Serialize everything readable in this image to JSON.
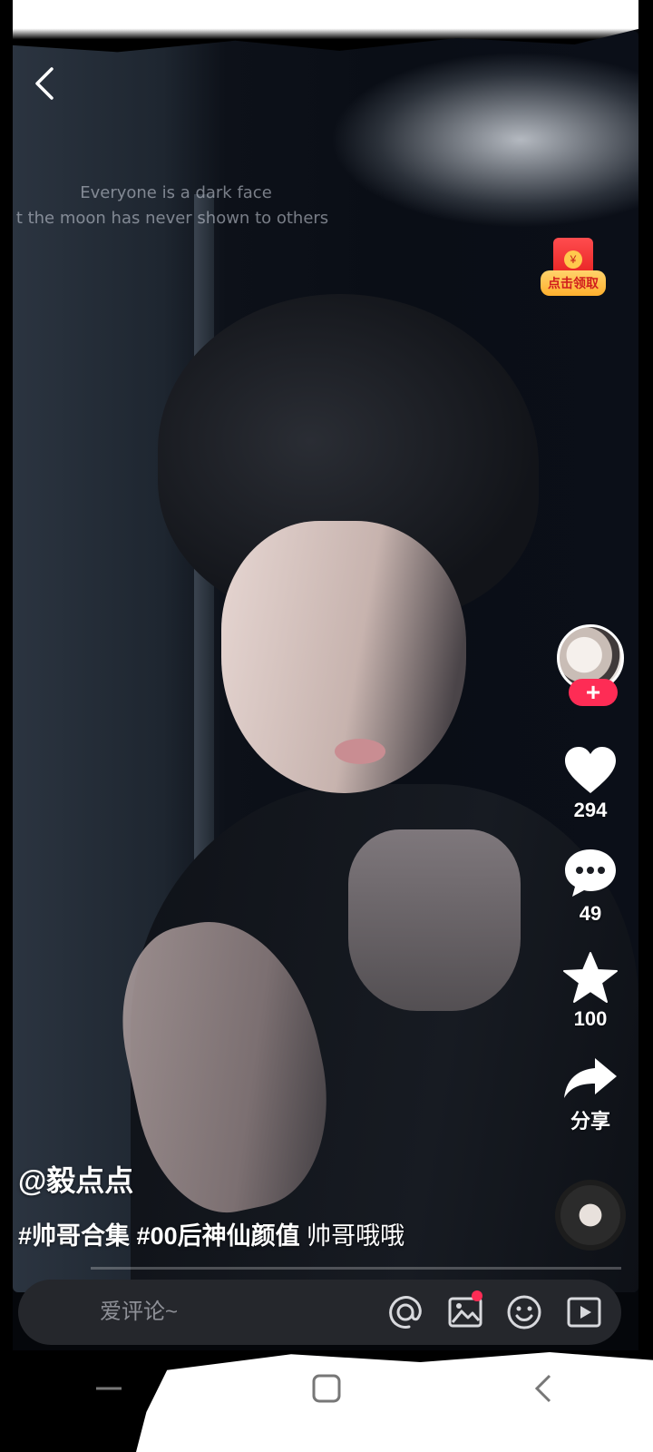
{
  "video": {
    "overlay_line1": "Everyone is a dark face",
    "overlay_line2": "t the moon has never shown to others"
  },
  "promo": {
    "coin_symbol": "¥",
    "claim_label": "点击领取"
  },
  "author": {
    "handle": "@毅点点",
    "follow_symbol": "+"
  },
  "actions": {
    "likes": "294",
    "comments": "49",
    "favorites": "100",
    "share_label": "分享"
  },
  "caption": {
    "tag1": "#帅哥合集",
    "tag2": "#00后神仙颜值",
    "text": "帅哥哦哦"
  },
  "playback": {
    "progress": 0.0
  },
  "comment_bar": {
    "placeholder": "爱评论~"
  },
  "colors": {
    "accent": "#fe2c55",
    "bar_bg": "#25272c",
    "promo_red": "#e6201f",
    "promo_gold": "#ffb02e"
  },
  "icons": {
    "back": "chevron-left-icon",
    "like": "heart-icon",
    "comment": "chat-bubble-icon",
    "favorite": "star-icon",
    "share": "share-arrow-icon",
    "mention": "at-icon",
    "image": "image-icon",
    "emoji": "emoji-icon",
    "video": "video-icon"
  }
}
